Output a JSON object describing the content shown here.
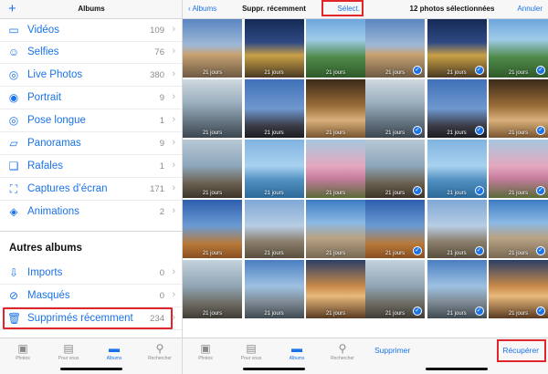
{
  "albums_panel": {
    "title": "Albums",
    "plus": "+",
    "rows": [
      {
        "label": "Vidéos",
        "count": "109",
        "icon": "video-icon"
      },
      {
        "label": "Selfies",
        "count": "76",
        "icon": "selfie-icon"
      },
      {
        "label": "Live Photos",
        "count": "380",
        "icon": "live-photo-icon"
      },
      {
        "label": "Portrait",
        "count": "9",
        "icon": "portrait-icon"
      },
      {
        "label": "Pose longue",
        "count": "1",
        "icon": "long-exposure-icon"
      },
      {
        "label": "Panoramas",
        "count": "9",
        "icon": "panorama-icon"
      },
      {
        "label": "Rafales",
        "count": "1",
        "icon": "burst-icon"
      },
      {
        "label": "Captures d’écran",
        "count": "171",
        "icon": "screenshot-icon"
      },
      {
        "label": "Animations",
        "count": "2",
        "icon": "animation-icon"
      }
    ],
    "section_title": "Autres albums",
    "other_rows": [
      {
        "label": "Imports",
        "count": "0",
        "icon": "import-icon"
      },
      {
        "label": "Masqués",
        "count": "0",
        "icon": "hidden-icon"
      },
      {
        "label": "Supprimés récemment",
        "count": "234",
        "icon": "trash-icon"
      }
    ]
  },
  "recent_panel": {
    "back_label": "Albums",
    "title": "Suppr. récemment",
    "select_label": "Sélect.",
    "days_label": "21 jours"
  },
  "selected_panel": {
    "title": "12 photos sélectionnées",
    "cancel_label": "Annuler",
    "delete_label": "Supprimer",
    "recover_label": "Récupérer"
  },
  "tabbar": {
    "items": [
      {
        "label": "Photos",
        "icon": "photos-icon"
      },
      {
        "label": "Pour vous",
        "icon": "for-you-icon"
      },
      {
        "label": "Albums",
        "icon": "albums-icon"
      },
      {
        "label": "Rechercher",
        "icon": "search-icon"
      }
    ],
    "active_index": 2
  },
  "colors": {
    "accent": "#1a73e8",
    "highlight": "#e0262b"
  }
}
